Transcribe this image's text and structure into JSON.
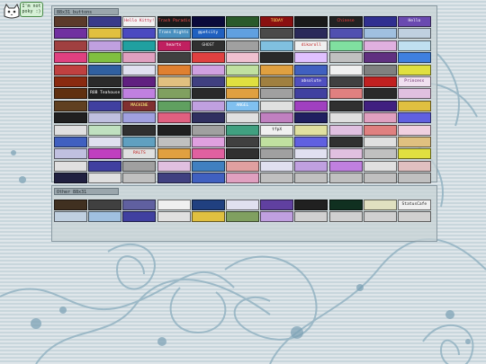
{
  "mascot": {
    "icon": "cat-face-icon",
    "bubble_text": "I'm not\npoky :)"
  },
  "panels": {
    "main": {
      "title": "88x31 buttons"
    },
    "sub": {
      "title": "Other 88x31"
    }
  },
  "main_buttons": [
    {
      "label": "",
      "bg": "#5b3a2a",
      "fg": "#ffd9a0"
    },
    {
      "label": "",
      "bg": "#3a3a8a",
      "fg": "#e0e0ff"
    },
    {
      "label": "Hello Kitty!",
      "bg": "#f2f2f2",
      "fg": "#c02040"
    },
    {
      "label": "Trash Paradise!",
      "bg": "#1a1a1a",
      "fg": "#ff5050"
    },
    {
      "label": "",
      "bg": "#0a0a3a",
      "fg": "#80ffff"
    },
    {
      "label": "",
      "bg": "#2a5a2a",
      "fg": "#c0ffc0"
    },
    {
      "label": "TODAY",
      "bg": "#8a1010",
      "fg": "#ffe060"
    },
    {
      "label": "",
      "bg": "#1a1a1a",
      "fg": "#ffffff"
    },
    {
      "label": "Chinese",
      "bg": "#222222",
      "fg": "#ff4040"
    },
    {
      "label": "",
      "bg": "#303090",
      "fg": "#ffffff"
    },
    {
      "label": "Hello",
      "bg": "#6a4ab0",
      "fg": "#ffffff"
    },
    {
      "label": "",
      "bg": "#7030a0",
      "fg": "#ffe0ff"
    },
    {
      "label": "",
      "bg": "#e0c040",
      "fg": "#202020"
    },
    {
      "label": "",
      "bg": "#4a4ac0",
      "fg": "#ffffff"
    },
    {
      "label": "Trans Rights",
      "bg": "#4a90c0",
      "fg": "#ffffff"
    },
    {
      "label": "@petcity",
      "bg": "#2060c0",
      "fg": "#ffffff"
    },
    {
      "label": "",
      "bg": "#60a0e0",
      "fg": "#ffffff"
    },
    {
      "label": "",
      "bg": "#4a4a4a",
      "fg": "#ffffff"
    },
    {
      "label": "",
      "bg": "#2a2a5a",
      "fg": "#ff80ff"
    },
    {
      "label": "",
      "bg": "#5050b0",
      "fg": "#ffffff"
    },
    {
      "label": "",
      "bg": "#a0c0e0",
      "fg": "#202040"
    },
    {
      "label": "",
      "bg": "#c0d0e0",
      "fg": "#202040"
    },
    {
      "label": "",
      "bg": "#a04040",
      "fg": "#ffffff"
    },
    {
      "label": "",
      "bg": "#c0a0e0",
      "fg": "#402060"
    },
    {
      "label": "",
      "bg": "#20a0a0",
      "fg": "#ffffff"
    },
    {
      "label": "hearts",
      "bg": "#c02060",
      "fg": "#ffffff"
    },
    {
      "label": "GHOST",
      "bg": "#303030",
      "fg": "#e0e0e0"
    },
    {
      "label": "",
      "bg": "#a0a0a0",
      "fg": "#202020"
    },
    {
      "label": "",
      "bg": "#80c0e0",
      "fg": "#ffffff"
    },
    {
      "label": "dikaroll",
      "bg": "#f0f0f0",
      "fg": "#c02020"
    },
    {
      "label": "",
      "bg": "#80e0a0",
      "fg": "#205020"
    },
    {
      "label": "",
      "bg": "#e0b0e0",
      "fg": "#602060"
    },
    {
      "label": "",
      "bg": "#c0e0f0",
      "fg": "#204060"
    },
    {
      "label": "",
      "bg": "#e04080",
      "fg": "#ffffff"
    },
    {
      "label": "",
      "bg": "#80c040",
      "fg": "#ffffff"
    },
    {
      "label": "",
      "bg": "#e0a0c0",
      "fg": "#ffffff"
    },
    {
      "label": "",
      "bg": "#404040",
      "fg": "#ffffff"
    },
    {
      "label": "",
      "bg": "#e04040",
      "fg": "#ffff80"
    },
    {
      "label": "",
      "bg": "#f0c0d0",
      "fg": "#c02060"
    },
    {
      "label": "",
      "bg": "#2a2a2a",
      "fg": "#e0e0e0"
    },
    {
      "label": "",
      "bg": "#e0c0ff",
      "fg": "#402080"
    },
    {
      "label": "",
      "bg": "#c0c0c0",
      "fg": "#202020"
    },
    {
      "label": "",
      "bg": "#603080",
      "fg": "#ffffff"
    },
    {
      "label": "",
      "bg": "#4080e0",
      "fg": "#ffffff"
    },
    {
      "label": "",
      "bg": "#c04040",
      "fg": "#ffffff"
    },
    {
      "label": "",
      "bg": "#3060a0",
      "fg": "#ffffff"
    },
    {
      "label": "",
      "bg": "#e0e0f0",
      "fg": "#404080"
    },
    {
      "label": "",
      "bg": "#e08030",
      "fg": "#ffffff"
    },
    {
      "label": "",
      "bg": "#d0a0e0",
      "fg": "#401060"
    },
    {
      "label": "",
      "bg": "#c0e0a0",
      "fg": "#204010"
    },
    {
      "label": "",
      "bg": "#e0a040",
      "fg": "#202020"
    },
    {
      "label": "",
      "bg": "#4060c0",
      "fg": "#ffffff"
    },
    {
      "label": "",
      "bg": "#f0f0f0",
      "fg": "#202020"
    },
    {
      "label": "",
      "bg": "#808080",
      "fg": "#ffffff"
    },
    {
      "label": "",
      "bg": "#e0e040",
      "fg": "#c02020"
    },
    {
      "label": "",
      "bg": "#8a2a10",
      "fg": "#ffe0a0"
    },
    {
      "label": "",
      "bg": "#2a2a2a",
      "fg": "#ffffff"
    },
    {
      "label": "",
      "bg": "#602080",
      "fg": "#ffffff"
    },
    {
      "label": "",
      "bg": "#e0c080",
      "fg": "#402010"
    },
    {
      "label": "",
      "bg": "#404080",
      "fg": "#ffffff"
    },
    {
      "label": "",
      "bg": "#e0e040",
      "fg": "#c02020"
    },
    {
      "label": "",
      "bg": "#a08040",
      "fg": "#ffffff"
    },
    {
      "label": "absolute",
      "bg": "#5050c0",
      "fg": "#ffffff"
    },
    {
      "label": "",
      "bg": "#404040",
      "fg": "#e0e0e0"
    },
    {
      "label": "",
      "bg": "#c02020",
      "fg": "#ffffff"
    },
    {
      "label": "Princess",
      "bg": "#f0e0f0",
      "fg": "#602060"
    },
    {
      "label": "",
      "bg": "#603010",
      "fg": "#ffc080"
    },
    {
      "label": "ROB Teahouse",
      "bg": "#202020",
      "fg": "#ffffff"
    },
    {
      "label": "",
      "bg": "#c080e0",
      "fg": "#ffffff"
    },
    {
      "label": "",
      "bg": "#80a060",
      "fg": "#ffffff"
    },
    {
      "label": "",
      "bg": "#2a2a2a",
      "fg": "#ff80ff"
    },
    {
      "label": "",
      "bg": "#e0a040",
      "fg": "#202020"
    },
    {
      "label": "",
      "bg": "#a0a0a0",
      "fg": "#202020"
    },
    {
      "label": "",
      "bg": "#4040a0",
      "fg": "#ffffff"
    },
    {
      "label": "",
      "bg": "#e08080",
      "fg": "#ffffff"
    },
    {
      "label": "",
      "bg": "#2a2a2a",
      "fg": "#ffffff"
    },
    {
      "label": "",
      "bg": "#e0c0e0",
      "fg": "#602060"
    },
    {
      "label": "",
      "bg": "#604020",
      "fg": "#ffffff"
    },
    {
      "label": "",
      "bg": "#4040a0",
      "fg": "#ffffff"
    },
    {
      "label": "MACHINE",
      "bg": "#803030",
      "fg": "#ffff80"
    },
    {
      "label": "",
      "bg": "#60a060",
      "fg": "#ffffff"
    },
    {
      "label": "",
      "bg": "#c0a0e0",
      "fg": "#402060"
    },
    {
      "label": "ANGEL",
      "bg": "#80c0f0",
      "fg": "#ffffff"
    },
    {
      "label": "",
      "bg": "#e0e0e0",
      "fg": "#202020"
    },
    {
      "label": "",
      "bg": "#a040c0",
      "fg": "#ffffff"
    },
    {
      "label": "",
      "bg": "#303030",
      "fg": "#ffffff"
    },
    {
      "label": "",
      "bg": "#402080",
      "fg": "#ffffff"
    },
    {
      "label": "",
      "bg": "#e0c040",
      "fg": "#202020"
    },
    {
      "label": "",
      "bg": "#202020",
      "fg": "#ffff40"
    },
    {
      "label": "",
      "bg": "#c0c0e0",
      "fg": "#202040"
    },
    {
      "label": "",
      "bg": "#a0a0e0",
      "fg": "#202040"
    },
    {
      "label": "",
      "bg": "#e06080",
      "fg": "#ffffff"
    },
    {
      "label": "",
      "bg": "#303060",
      "fg": "#ffffff"
    },
    {
      "label": "",
      "bg": "#e0e0e0",
      "fg": "#202020"
    },
    {
      "label": "",
      "bg": "#c080c0",
      "fg": "#ffffff"
    },
    {
      "label": "",
      "bg": "#202060",
      "fg": "#ffffff"
    },
    {
      "label": "",
      "bg": "#e0e0e0",
      "fg": "#202020"
    },
    {
      "label": "",
      "bg": "#e0a0c0",
      "fg": "#602040"
    },
    {
      "label": "",
      "bg": "#6060e0",
      "fg": "#ffffff"
    },
    {
      "label": "",
      "bg": "#e0e0e0",
      "fg": "#206020"
    },
    {
      "label": "",
      "bg": "#c0e0c0",
      "fg": "#204020"
    },
    {
      "label": "",
      "bg": "#303030",
      "fg": "#e0e0e0"
    },
    {
      "label": "",
      "bg": "#202020",
      "fg": "#ffffff"
    },
    {
      "label": "",
      "bg": "#a0a0a0",
      "fg": "#202020"
    },
    {
      "label": "",
      "bg": "#40a080",
      "fg": "#ffffff"
    },
    {
      "label": "tfpX",
      "bg": "#f0f0f0",
      "fg": "#202020"
    },
    {
      "label": "",
      "bg": "#e0e0a0",
      "fg": "#404020"
    },
    {
      "label": "",
      "bg": "#e0c0e0",
      "fg": "#602060"
    },
    {
      "label": "",
      "bg": "#e08080",
      "fg": "#ffffff"
    },
    {
      "label": "",
      "bg": "#f0d0e0",
      "fg": "#602040"
    },
    {
      "label": "",
      "bg": "#4060c0",
      "fg": "#ffffff"
    },
    {
      "label": "",
      "bg": "#e0e0f0",
      "fg": "#404080"
    },
    {
      "label": "",
      "bg": "#60a0c0",
      "fg": "#ffffff"
    },
    {
      "label": "",
      "bg": "#c0c0c0",
      "fg": "#202020"
    },
    {
      "label": "",
      "bg": "#e0a0e0",
      "fg": "#602060"
    },
    {
      "label": "",
      "bg": "#404040",
      "fg": "#ffffff"
    },
    {
      "label": "",
      "bg": "#c0e0a0",
      "fg": "#204010"
    },
    {
      "label": "",
      "bg": "#6060e0",
      "fg": "#ffffff"
    },
    {
      "label": "",
      "bg": "#303030",
      "fg": "#e0e0e0"
    },
    {
      "label": "",
      "bg": "#e0e0e0",
      "fg": "#202020"
    },
    {
      "label": "",
      "bg": "#e0c080",
      "fg": "#402010"
    },
    {
      "label": "",
      "bg": "#c0c0e0",
      "fg": "#202040"
    },
    {
      "label": "",
      "bg": "#c040c0",
      "fg": "#ffffff"
    },
    {
      "label": "RALTS",
      "bg": "#e0e0e0",
      "fg": "#c02020"
    },
    {
      "label": "",
      "bg": "#e0a040",
      "fg": "#202020"
    },
    {
      "label": "",
      "bg": "#e060a0",
      "fg": "#ffffff"
    },
    {
      "label": "",
      "bg": "#303030",
      "fg": "#ffffff"
    },
    {
      "label": "",
      "bg": "#a0a0a0",
      "fg": "#202020"
    },
    {
      "label": "",
      "bg": "#e0e0f0",
      "fg": "#404080"
    },
    {
      "label": "",
      "bg": "#e0c0e0",
      "fg": "#602060"
    },
    {
      "label": "",
      "bg": "#c0c0c0",
      "fg": "#202020"
    },
    {
      "label": "",
      "bg": "#e0e040",
      "fg": "#c02020"
    },
    {
      "label": "",
      "bg": "#e0e0e0",
      "fg": "#202020"
    },
    {
      "label": "",
      "bg": "#4040a0",
      "fg": "#ffffff"
    },
    {
      "label": "",
      "bg": "#a0a0a0",
      "fg": "#202020"
    },
    {
      "label": "",
      "bg": "#e0c0e0",
      "fg": "#602060"
    },
    {
      "label": "",
      "bg": "#4080c0",
      "fg": "#ffffff"
    },
    {
      "label": "",
      "bg": "#e0a0a0",
      "fg": "#602020"
    },
    {
      "label": "",
      "bg": "#e0e0f0",
      "fg": "#404080"
    },
    {
      "label": "",
      "bg": "#c0a0e0",
      "fg": "#402060"
    },
    {
      "label": "",
      "bg": "#c080e0",
      "fg": "#ffffff"
    },
    {
      "label": "",
      "bg": "#e0e0e0",
      "fg": "#202020"
    },
    {
      "label": "",
      "bg": "#e0c0c0",
      "fg": "#602020"
    },
    {
      "label": "",
      "bg": "#202040",
      "fg": "#ffffff"
    },
    {
      "label": "",
      "bg": "#e0e0e0",
      "fg": "#202020"
    },
    {
      "label": "",
      "bg": "#c0c0c0",
      "fg": "#202020"
    },
    {
      "label": "",
      "bg": "#404080",
      "fg": "#ffffff"
    },
    {
      "label": "",
      "bg": "#4060c0",
      "fg": "#ffffff"
    },
    {
      "label": "",
      "bg": "#e0a0c0",
      "fg": "#602040"
    },
    {
      "label": "",
      "bg": "#c0c0c0",
      "fg": "#202020"
    },
    {
      "label": "",
      "bg": "#c0c0c0",
      "fg": "#202020"
    },
    {
      "label": "",
      "bg": "#c0c0c0",
      "fg": "#202020"
    },
    {
      "label": "",
      "bg": "#c0c0c0",
      "fg": "#202020"
    },
    {
      "label": "",
      "bg": "#c0c0c0",
      "fg": "#202020"
    }
  ],
  "sub_buttons": [
    {
      "label": "",
      "bg": "#403020",
      "fg": "#ffe0a0"
    },
    {
      "label": "",
      "bg": "#404040",
      "fg": "#ffffff"
    },
    {
      "label": "",
      "bg": "#6060a0",
      "fg": "#ffffff"
    },
    {
      "label": "",
      "bg": "#f0f0f0",
      "fg": "#202020"
    },
    {
      "label": "",
      "bg": "#204080",
      "fg": "#ffffff"
    },
    {
      "label": "",
      "bg": "#e0e0f0",
      "fg": "#404080"
    },
    {
      "label": "",
      "bg": "#6040a0",
      "fg": "#ffffff"
    },
    {
      "label": "",
      "bg": "#202020",
      "fg": "#ffffff"
    },
    {
      "label": "",
      "bg": "#103020",
      "fg": "#80ff80"
    },
    {
      "label": "",
      "bg": "#e0e0c0",
      "fg": "#404020"
    },
    {
      "label": "StatusCafe",
      "bg": "#f0f0f0",
      "fg": "#202020"
    },
    {
      "label": "",
      "bg": "#c0d0e0",
      "fg": "#204060"
    },
    {
      "label": "",
      "bg": "#a0c0e0",
      "fg": "#ffffff"
    },
    {
      "label": "",
      "bg": "#4040a0",
      "fg": "#ffffff"
    },
    {
      "label": "",
      "bg": "#e0e0e0",
      "fg": "#202020"
    },
    {
      "label": "",
      "bg": "#e0c040",
      "fg": "#202020"
    },
    {
      "label": "",
      "bg": "#80a060",
      "fg": "#ffffff"
    },
    {
      "label": "",
      "bg": "#c0a0e0",
      "fg": "#402060"
    },
    {
      "label": "",
      "bg": "#d0d0d0",
      "fg": "#202020"
    },
    {
      "label": "",
      "bg": "#d0d0d0",
      "fg": "#202020"
    },
    {
      "label": "",
      "bg": "#d0d0d0",
      "fg": "#202020"
    },
    {
      "label": "",
      "bg": "#d0d0d0",
      "fg": "#202020"
    }
  ]
}
